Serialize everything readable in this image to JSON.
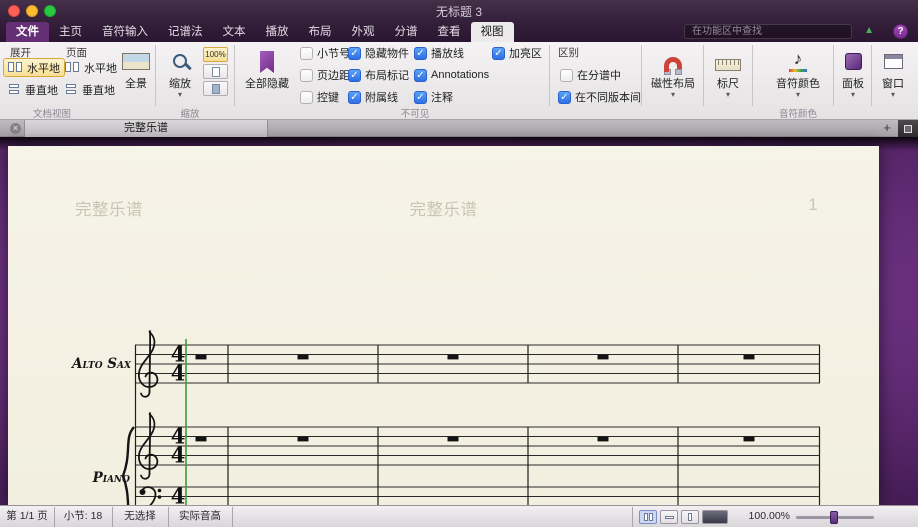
{
  "glyphs": {
    "dropdown": "▾",
    "close": "×",
    "add": "+",
    "check": "✓",
    "help": "?",
    "triangle": "▲",
    "note": "♪"
  },
  "window": {
    "title": "无标题 3"
  },
  "tabs": {
    "items": [
      {
        "label": "文件"
      },
      {
        "label": "主页"
      },
      {
        "label": "音符输入"
      },
      {
        "label": "记谱法"
      },
      {
        "label": "文本"
      },
      {
        "label": "播放"
      },
      {
        "label": "布局"
      },
      {
        "label": "外观"
      },
      {
        "label": "分谱"
      },
      {
        "label": "查看"
      },
      {
        "label": "视图"
      }
    ],
    "active": "视图",
    "search_placeholder": "在功能区中查找"
  },
  "ribbon": {
    "doc_view": {
      "group_label": "文档视图",
      "spread_label": "展开",
      "pages_label": "页面",
      "spread_horizontal": "水平地",
      "spread_vertical": "垂直地",
      "pages_horizontal": "水平地",
      "pages_vertical": "垂直地",
      "panorama": "全景"
    },
    "zoom": {
      "group_label": "缩放",
      "button": "缩放",
      "percent": "100%"
    },
    "hide_all": "全部隐藏",
    "invisibles": {
      "group_label": "不可见",
      "items": [
        {
          "label": "小节号",
          "checked": false
        },
        {
          "label": "页边距",
          "checked": false
        },
        {
          "label": "控键",
          "checked": false
        },
        {
          "label": "隐藏物件",
          "checked": true
        },
        {
          "label": "布局标记",
          "checked": true
        },
        {
          "label": "附属线",
          "checked": true
        },
        {
          "label": "播放线",
          "checked": true
        },
        {
          "label": "Annotations",
          "checked": true
        },
        {
          "label": "注释",
          "checked": true
        },
        {
          "label": "加亮区",
          "checked": true
        }
      ]
    },
    "differences": {
      "label": "区别",
      "items": [
        {
          "label": "在分谱中",
          "checked": false
        },
        {
          "label": "在不同版本间",
          "checked": true
        }
      ]
    },
    "magnetic_layout": "磁性布局",
    "rulers": "标尺",
    "note_colors": {
      "button": "音符颜色",
      "group_label": "音符颜色"
    },
    "panels": "面板",
    "window_button": "窗口"
  },
  "doc_tabs": {
    "active": "完整乐谱"
  },
  "score": {
    "header_left": "完整乐谱",
    "header_center": "完整乐谱",
    "page_number": "1",
    "instruments": [
      {
        "name": "Alto Sax"
      },
      {
        "name": "Piano"
      }
    ],
    "time_signature": {
      "top": "4",
      "bottom": "4"
    },
    "colors": {
      "page": "#f5f2e4",
      "desk": "#6b3180",
      "playback_line": "#3a9e3c"
    }
  },
  "statusbar": {
    "page": "第 1/1 页",
    "bars": "小节: 18",
    "selection": "无选择",
    "pitch": "实际音高",
    "zoom_percent": "100.00%"
  }
}
